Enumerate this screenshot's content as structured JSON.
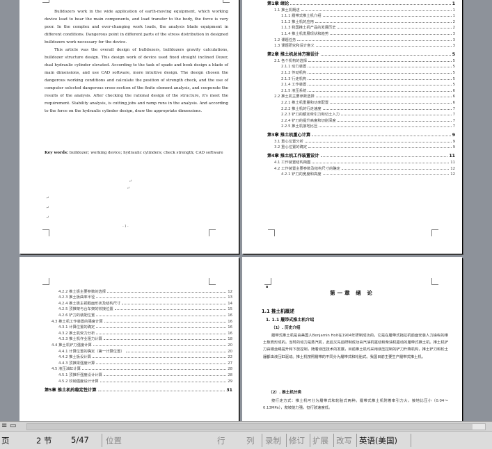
{
  "page1": {
    "abstract_paragraphs": [
      "Bulldozers work in the wide application of earth-moving equipment, which working device lead to bear the main components, and load transfer to the body, the force is very poor. In the complex and ever-changing work loads, the analysis blade equipment in different conditions. Dangerous point in different parts of the stress distribution in designed bulldozers work necessary for the device.",
      "This article was the overall design of bulldozers, bulldozers gravity calculations, bulldozer structure design. This design work of device used fixed straight inclined Dozer, dual hydraulic cylinder elevated. According to the task of spade and book design a blade of main dimensions, and use CAD software, more intuitive design. The design chosen the dangerous working conditions and calculate the position of strength check, and the use of computer selected dangerous cross-section of the finite element analysis, and cooperate the results of the analysis. After checking the rational design of the structure, it's meet the requirement. Stability analysis, is cutting jobs and ramp runs in the analysis. And according to the force on the hydraulic cylinder design, draw the appropriate dimensions."
    ],
    "keywords_label": "Key words:",
    "keywords_text": "bulldozer; working device; hydraulic cylinders; check strength; CAD software",
    "page_number": "- I -"
  },
  "page2": {
    "toc": [
      {
        "label": "第1章 绪论",
        "page": "1",
        "level": 0
      },
      {
        "label": "1.1 推土机概述",
        "page": "1",
        "level": 1
      },
      {
        "label": "1.1.1 履带式推土机介绍",
        "page": "1",
        "level": 2
      },
      {
        "label": "1.1.2 推土机的应用",
        "page": "2",
        "level": 2
      },
      {
        "label": "1.1.3 我国推土机产品的发展历史",
        "page": "2",
        "level": 2
      },
      {
        "label": "1.1.4 推土机发展现状和趋势",
        "page": "3",
        "level": 2
      },
      {
        "label": "1.2 课题任务",
        "page": "3",
        "level": 1
      },
      {
        "label": "1.3 课题研究和设计意义",
        "page": "3",
        "level": 1
      },
      {
        "label": "第2章 推土机总体方案设计",
        "page": "5",
        "level": 0
      },
      {
        "label": "2.1 各个机构的选择",
        "page": "5",
        "level": 1
      },
      {
        "label": "2.1.1 动力装置",
        "page": "5",
        "level": 2
      },
      {
        "label": "2.1.2 传动机构",
        "page": "5",
        "level": 2
      },
      {
        "label": "2.1.3 行走机构",
        "page": "5",
        "level": 2
      },
      {
        "label": "2.1.4 工作装置",
        "page": "5",
        "level": 2
      },
      {
        "label": "2.1.5 液压系统",
        "page": "6",
        "level": 2
      },
      {
        "label": "2.2 推土机主要参数选择",
        "page": "6",
        "level": 1
      },
      {
        "label": "2.2.1 推土机重量和功率配置",
        "page": "6",
        "level": 2
      },
      {
        "label": "2.2.2 推土机的行走速度",
        "page": "7",
        "level": 2
      },
      {
        "label": "2.2.3 铲刀的额定牵引力和切土入力",
        "page": "7",
        "level": 2
      },
      {
        "label": "2.2.4 铲刀的提升高度和切削深度",
        "page": "7",
        "level": 2
      },
      {
        "label": "2.2.5 推土机接地比压",
        "page": "7",
        "level": 2
      },
      {
        "label": "第3章 推土机重心计算",
        "page": "9",
        "level": 0
      },
      {
        "label": "3.1 重心位置分析",
        "page": "9",
        "level": 1
      },
      {
        "label": "3.2 重心位置的确定",
        "page": "9",
        "level": 1
      },
      {
        "label": "第4章 推土机工作装置设计",
        "page": "11",
        "level": 0
      },
      {
        "label": "4.1 工作装置结构简图",
        "page": "11",
        "level": 1
      },
      {
        "label": "4.2 工作装置主要参数及结构尺寸的确定",
        "page": "12",
        "level": 1
      },
      {
        "label": "4.2.1 铲刀的宽度和高度",
        "page": "12",
        "level": 2
      }
    ]
  },
  "page3": {
    "toc": [
      {
        "label": "4.2.2 推土板主要参数的选择",
        "page": "12",
        "level": 2
      },
      {
        "label": "4.2.3 推土板曲率半径",
        "page": "13",
        "level": 2
      },
      {
        "label": "4.2.4 推土板主视截面形状及结构尺寸",
        "page": "14",
        "level": 2
      },
      {
        "label": "4.2.5 顶推架与台车架的铰接位置",
        "page": "15",
        "level": 2
      },
      {
        "label": "4.2.6 铲刀的装配位置",
        "page": "16",
        "level": 2
      },
      {
        "label": "4.3 推土机工作装置的强度计算",
        "page": "16",
        "level": 1
      },
      {
        "label": "4.3.1 计算位置的确定",
        "page": "16",
        "level": 2
      },
      {
        "label": "4.3.2 推土机受力分析",
        "page": "16",
        "level": 2
      },
      {
        "label": "4.3.3 推土机作业阻力计算",
        "page": "18",
        "level": 2
      },
      {
        "label": "4.4 推土机铲刀强度计算",
        "page": "20",
        "level": 1
      },
      {
        "label": "4.4.1 计算位置的确定（第一计算位置）",
        "page": "20",
        "level": 2
      },
      {
        "label": "4.4.2 推土板设计算",
        "page": "22",
        "level": 2
      },
      {
        "label": "4.4.3 顶推梁强度计算",
        "page": "27",
        "level": 2
      },
      {
        "label": "4.5 液压油缸计算",
        "page": "28",
        "level": 1
      },
      {
        "label": "4.5.1 顶推杆强度设计计算",
        "page": "28",
        "level": 2
      },
      {
        "label": "4.5.2 铰销强度设计计算",
        "page": "29",
        "level": 2
      },
      {
        "label": "第5章 推土机的稳定性计算",
        "page": "31",
        "level": 0
      }
    ]
  },
  "page4": {
    "chapter_title": "第一章 绪 论",
    "section": "1.1 推土机概述",
    "subsection": "1. 1.1 履带式推土机介绍",
    "item1": "（1）. 历史介绍",
    "paragraph1": "履带式推土机是由美国人Benjamin Holt在1904年研制成功的，它是在履带式拖拉机前面安装人力操纵的推土板而形成的。当时的动力是蒸汽机，此后又先后研制成功由汽油机驱动和柴油机驱动的履带式推土机。推土机铲刀由钢丝绳提升和下放控制，随着液压技术的发展，目前推土机均采用液压控制的铲刀升降机构，推土铲刀和松土器都由液压缸驱动。推土机按照履带的不同分为履带式和轮胎式。我国目前主要生产履带式推土机。",
    "item2": "（2）. 推土机分类",
    "paragraph2": "按行走方式：推土机可分为履带式和轮胎式两种。履带式推土机附着牵引力大，接地比压小（0.04～0.13MPa），爬坡能力强，但行驶速度低。"
  },
  "status_bar": {
    "page_label": "页",
    "section": "2 节",
    "page_of_total": "5/47",
    "position_label": "位置",
    "line_label": "行",
    "column_label": "列",
    "record": "录制",
    "revision": "修订",
    "extend": "扩展",
    "overtype": "改写",
    "language": "英语(美国)"
  }
}
